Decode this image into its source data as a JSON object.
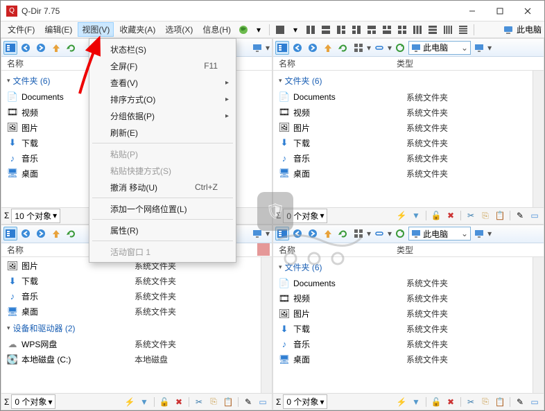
{
  "app": {
    "title": "Q-Dir 7.75"
  },
  "menubar": {
    "items": [
      "文件(F)",
      "编辑(E)",
      "视图(V)",
      "收藏夹(A)",
      "选项(X)",
      "信息(H)"
    ],
    "right_label": "此电脑"
  },
  "dropdown": {
    "items": [
      {
        "label": "状态栏(S)",
        "kb": "",
        "sub": false,
        "dis": false
      },
      {
        "label": "全屏(F)",
        "kb": "F11",
        "sub": false,
        "dis": false
      },
      {
        "label": "查看(V)",
        "kb": "",
        "sub": true,
        "dis": false
      },
      {
        "label": "排序方式(O)",
        "kb": "",
        "sub": true,
        "dis": false
      },
      {
        "label": "分组依据(P)",
        "kb": "",
        "sub": true,
        "dis": false
      },
      {
        "label": "刷新(E)",
        "kb": "",
        "sub": false,
        "dis": false
      },
      {
        "sep": true
      },
      {
        "label": "粘贴(P)",
        "kb": "",
        "sub": false,
        "dis": true
      },
      {
        "label": "粘贴快捷方式(S)",
        "kb": "",
        "sub": false,
        "dis": true
      },
      {
        "label": "撤消 移动(U)",
        "kb": "Ctrl+Z",
        "sub": false,
        "dis": false
      },
      {
        "sep": true
      },
      {
        "label": "添加一个网络位置(L)",
        "kb": "",
        "sub": false,
        "dis": false
      },
      {
        "sep": true
      },
      {
        "label": "属性(R)",
        "kb": "",
        "sub": false,
        "dis": false
      },
      {
        "sep": true
      },
      {
        "label": "活动窗口 1",
        "kb": "",
        "sub": false,
        "dis": true
      }
    ]
  },
  "columns": {
    "name": "名称",
    "type": "类型"
  },
  "addr": {
    "label": "此电脑"
  },
  "groups": {
    "folders": "文件夹 (6)",
    "drives": "设备和驱动器 (2)"
  },
  "items": {
    "documents": {
      "name": "Documents",
      "type": "系统文件夹",
      "icon": "doc"
    },
    "videos": {
      "name": "视频",
      "type": "系统文件夹",
      "icon": "vid"
    },
    "pictures": {
      "name": "图片",
      "type": "系统文件夹",
      "icon": "pic"
    },
    "downloads": {
      "name": "下载",
      "type": "系统文件夹",
      "icon": "dl"
    },
    "music": {
      "name": "音乐",
      "type": "系统文件夹",
      "icon": "mus"
    },
    "desktop": {
      "name": "桌面",
      "type": "系统文件夹",
      "icon": "dsk"
    },
    "wps": {
      "name": "WPS网盘",
      "type": "系统文件夹",
      "icon": "cloud"
    },
    "diskc": {
      "name": "本地磁盘 (C:)",
      "type": "本地磁盘",
      "icon": "disk"
    }
  },
  "status": {
    "count10": "10 个对象",
    "count0": "0 个对象",
    "sigma": "Σ"
  }
}
